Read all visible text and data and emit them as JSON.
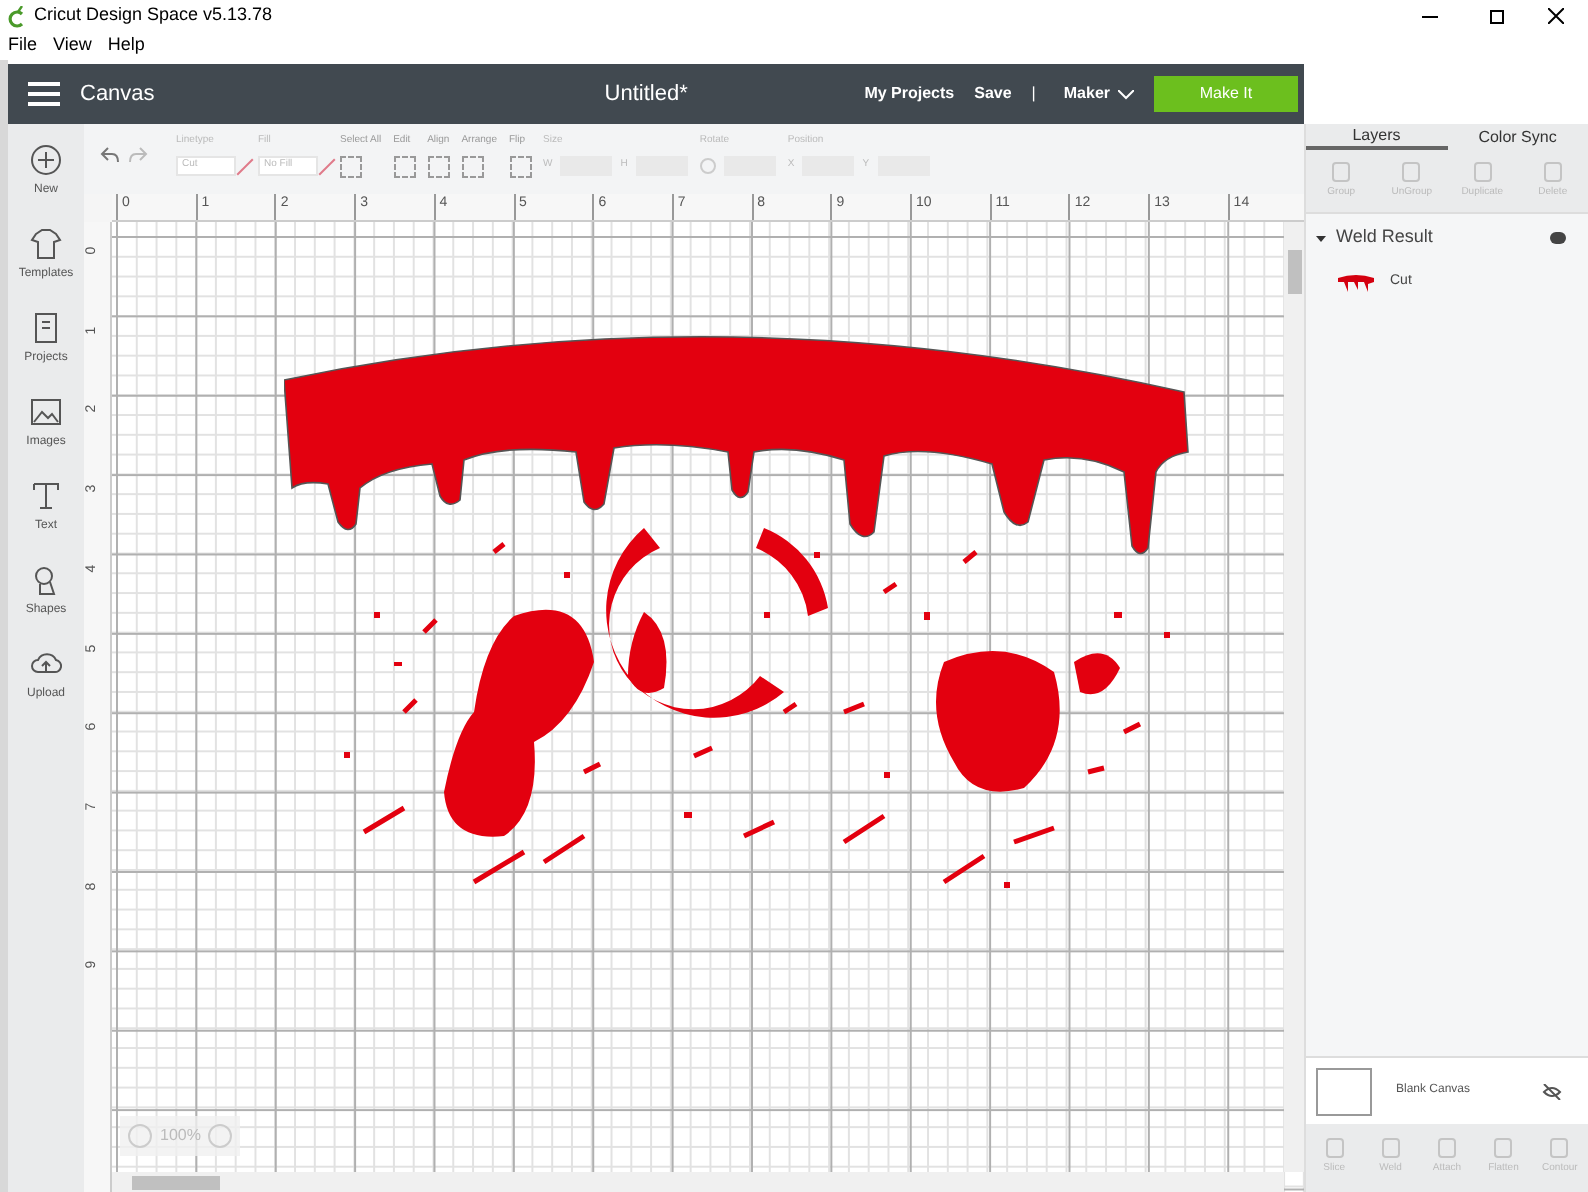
{
  "window": {
    "title": "Cricut Design Space  v5.13.78"
  },
  "menu": [
    "File",
    "View",
    "Help"
  ],
  "header": {
    "section": "Canvas",
    "document": "Untitled*",
    "links": [
      "My Projects",
      "Save"
    ],
    "separator": "|",
    "machine": "Maker",
    "action": "Make It"
  },
  "toolbar": {
    "groups": [
      {
        "label": "Linetype",
        "kind": "select",
        "value": "Cut"
      },
      {
        "label": "Fill",
        "kind": "select",
        "value": "No Fill"
      },
      {
        "label": "Select All",
        "kind": "icon"
      },
      {
        "label": "Edit",
        "kind": "icon"
      },
      {
        "label": "Align",
        "kind": "icon"
      },
      {
        "label": "Arrange",
        "kind": "icon"
      },
      {
        "label": "Flip",
        "kind": "icon"
      },
      {
        "label": "Size",
        "kind": "pair",
        "fields": [
          "W",
          "H"
        ]
      },
      {
        "label": "Rotate",
        "kind": "rotate"
      },
      {
        "label": "Position",
        "kind": "pair",
        "fields": [
          "X",
          "Y"
        ]
      }
    ]
  },
  "sidebar": {
    "items": [
      {
        "label": "New"
      },
      {
        "label": "Templates"
      },
      {
        "label": "Projects"
      },
      {
        "label": "Images"
      },
      {
        "label": "Text"
      },
      {
        "label": "Shapes"
      },
      {
        "label": "Upload"
      }
    ]
  },
  "rulers": {
    "horizontal": [
      "0",
      "1",
      "2",
      "3",
      "4",
      "5",
      "6",
      "7",
      "8",
      "9",
      "10",
      "11",
      "12",
      "13",
      "14"
    ],
    "vertical": [
      "0",
      "1",
      "2",
      "3",
      "4",
      "5",
      "6",
      "7",
      "8",
      "9"
    ]
  },
  "zoom": {
    "value": "100%"
  },
  "panel": {
    "tabs": [
      {
        "label": "Layers",
        "selected": true
      },
      {
        "label": "Color Sync",
        "selected": false
      }
    ],
    "actions": [
      "Group",
      "UnGroup",
      "Duplicate",
      "Delete"
    ],
    "layers": [
      {
        "label": "Weld Result",
        "expanded": true,
        "children": [
          {
            "label": "Cut"
          }
        ]
      }
    ],
    "canvas_label": "Blank Canvas",
    "bottom_actions": [
      "Slice",
      "Weld",
      "Attach",
      "Flatten",
      "Contour"
    ]
  }
}
